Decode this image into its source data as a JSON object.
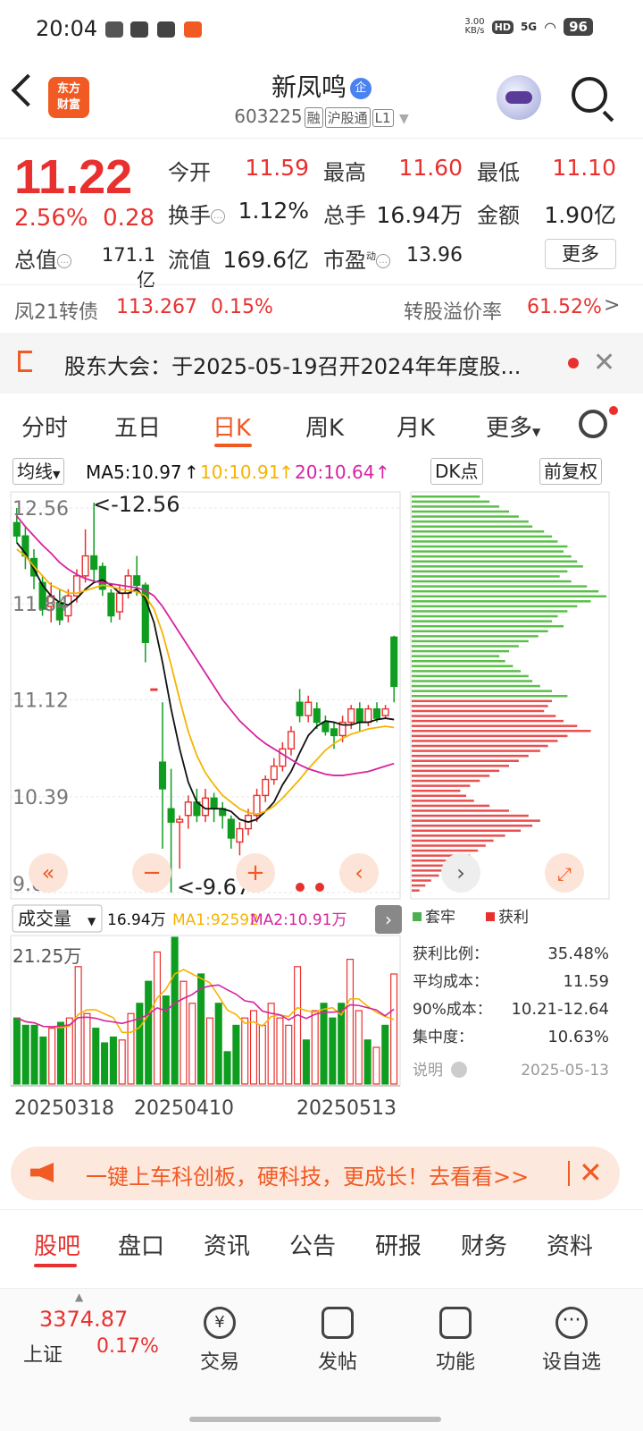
{
  "status_bar": {
    "time": "20:04",
    "net_speed_top": "3.00",
    "net_speed_unit": "KB/s",
    "hd": "HD",
    "network": "5G",
    "battery": "96"
  },
  "header": {
    "logo_line1": "东方",
    "logo_line2": "财富",
    "stock_name": "新凤鸣",
    "ent_badge": "企",
    "code": "603225",
    "tag_margin": "融",
    "tag_connect": "沪股通",
    "tag_level": "L1"
  },
  "quote": {
    "price": "11.22",
    "change_pct": "2.56%",
    "change_amt": "0.28",
    "open_label": "今开",
    "open": "11.59",
    "high_label": "最高",
    "high": "11.60",
    "low_label": "最低",
    "low": "11.10",
    "turnover_label": "换手",
    "turnover": "1.12%",
    "volume_label": "总手",
    "volume": "16.94万",
    "amount_label": "金额",
    "amount": "1.90亿",
    "mktcap_label": "总值",
    "mktcap": "171.1亿",
    "float_label": "流值",
    "float": "169.6亿",
    "pe_label": "市盈",
    "pe_sup": "动",
    "pe": "13.96",
    "more_button": "更多"
  },
  "bond": {
    "name": "凤21转债",
    "price": "113.267",
    "change": "0.15%",
    "premium_label": "转股溢价率",
    "premium": "61.52%"
  },
  "notice": {
    "text": "股东大会：于2025-05-19召开2024年年度股..."
  },
  "period_tabs": [
    "分时",
    "五日",
    "日K",
    "周K",
    "月K",
    "更多"
  ],
  "active_period": "日K",
  "ma_row": {
    "select": "均线",
    "ma5": "MA5:10.97",
    "ma10": "10:10.91",
    "ma20": "20:10.64",
    "dk": "DK点",
    "adjust": "前复权"
  },
  "colors": {
    "up": "#e8312f",
    "down": "#0f9d20",
    "ma5": "#111111",
    "ma10": "#f5b400",
    "ma20": "#d6249f",
    "brand": "#f15a22"
  },
  "chart_data": {
    "type": "candlestick",
    "y_ticks": [
      "12.56",
      "11.84",
      "11.12",
      "10.39",
      "9.67"
    ],
    "ylim": [
      9.67,
      12.56
    ],
    "max_label": "<-12.56",
    "min_label": "<-9.67",
    "x_labels": [
      "20250318",
      "20250410",
      "20250513"
    ],
    "candles": [
      {
        "o": 12.45,
        "c": 12.35,
        "h": 12.56,
        "l": 12.3
      },
      {
        "o": 12.35,
        "c": 12.2,
        "h": 12.42,
        "l": 12.1
      },
      {
        "o": 12.18,
        "c": 12.05,
        "h": 12.25,
        "l": 11.95
      },
      {
        "o": 12.0,
        "c": 11.8,
        "h": 12.05,
        "l": 11.75
      },
      {
        "o": 11.82,
        "c": 11.9,
        "h": 12.0,
        "l": 11.7
      },
      {
        "o": 11.85,
        "c": 11.72,
        "h": 11.95,
        "l": 11.68
      },
      {
        "o": 11.75,
        "c": 11.9,
        "h": 11.95,
        "l": 11.7
      },
      {
        "o": 11.9,
        "c": 12.05,
        "h": 12.1,
        "l": 11.85
      },
      {
        "o": 12.05,
        "c": 12.2,
        "h": 12.4,
        "l": 12.0
      },
      {
        "o": 12.2,
        "c": 12.1,
        "h": 12.6,
        "l": 12.0
      },
      {
        "o": 12.12,
        "c": 11.95,
        "h": 12.15,
        "l": 11.9
      },
      {
        "o": 11.92,
        "c": 11.75,
        "h": 11.95,
        "l": 11.7
      },
      {
        "o": 11.78,
        "c": 11.92,
        "h": 11.98,
        "l": 11.72
      },
      {
        "o": 11.92,
        "c": 12.05,
        "h": 12.1,
        "l": 11.88
      },
      {
        "o": 12.05,
        "c": 11.98,
        "h": 12.2,
        "l": 11.9
      },
      {
        "o": 11.98,
        "c": 11.55,
        "h": 12.0,
        "l": 11.4
      },
      {
        "o": 11.2,
        "c": 11.2,
        "h": 11.2,
        "l": 11.2
      },
      {
        "o": 10.65,
        "c": 10.45,
        "h": 11.1,
        "l": 10.0
      },
      {
        "o": 10.3,
        "c": 10.2,
        "h": 10.6,
        "l": 9.67
      },
      {
        "o": 10.2,
        "c": 10.22,
        "h": 10.25,
        "l": 9.85
      },
      {
        "o": 10.25,
        "c": 10.35,
        "h": 10.4,
        "l": 10.15
      },
      {
        "o": 10.35,
        "c": 10.25,
        "h": 10.45,
        "l": 10.2
      },
      {
        "o": 10.25,
        "c": 10.38,
        "h": 10.45,
        "l": 10.2
      },
      {
        "o": 10.38,
        "c": 10.3,
        "h": 10.42,
        "l": 10.2
      },
      {
        "o": 10.3,
        "c": 10.25,
        "h": 10.35,
        "l": 10.15
      },
      {
        "o": 10.22,
        "c": 10.08,
        "h": 10.25,
        "l": 10.0
      },
      {
        "o": 10.05,
        "c": 10.15,
        "h": 10.2,
        "l": 9.95
      },
      {
        "o": 10.15,
        "c": 10.25,
        "h": 10.3,
        "l": 10.1
      },
      {
        "o": 10.25,
        "c": 10.4,
        "h": 10.45,
        "l": 10.2
      },
      {
        "o": 10.4,
        "c": 10.52,
        "h": 10.55,
        "l": 10.35
      },
      {
        "o": 10.52,
        "c": 10.62,
        "h": 10.68,
        "l": 10.48
      },
      {
        "o": 10.62,
        "c": 10.75,
        "h": 10.8,
        "l": 10.58
      },
      {
        "o": 10.75,
        "c": 10.88,
        "h": 10.92,
        "l": 10.7
      },
      {
        "o": 11.1,
        "c": 11.0,
        "h": 11.2,
        "l": 10.95
      },
      {
        "o": 11.0,
        "c": 11.1,
        "h": 11.15,
        "l": 10.95
      },
      {
        "o": 11.05,
        "c": 10.95,
        "h": 11.1,
        "l": 10.9
      },
      {
        "o": 10.95,
        "c": 10.88,
        "h": 11.0,
        "l": 10.85
      },
      {
        "o": 10.9,
        "c": 10.85,
        "h": 10.95,
        "l": 10.75
      },
      {
        "o": 10.85,
        "c": 10.95,
        "h": 11.0,
        "l": 10.8
      },
      {
        "o": 10.95,
        "c": 11.05,
        "h": 11.08,
        "l": 10.9
      },
      {
        "o": 11.05,
        "c": 10.95,
        "h": 11.1,
        "l": 10.88
      },
      {
        "o": 10.95,
        "c": 11.05,
        "h": 11.08,
        "l": 10.92
      },
      {
        "o": 11.05,
        "c": 10.98,
        "h": 11.1,
        "l": 10.95
      },
      {
        "o": 11.0,
        "c": 11.05,
        "h": 11.08,
        "l": 10.98
      },
      {
        "o": 11.59,
        "c": 11.22,
        "h": 11.6,
        "l": 11.1
      }
    ],
    "ma5": [
      12.3,
      12.22,
      12.1,
      11.98,
      11.9,
      11.85,
      11.83,
      11.88,
      11.95,
      12.0,
      12.02,
      11.98,
      11.92,
      11.92,
      11.95,
      11.88,
      11.7,
      11.4,
      11.05,
      10.75,
      10.5,
      10.35,
      10.3,
      10.3,
      10.3,
      10.28,
      10.22,
      10.2,
      10.22,
      10.28,
      10.35,
      10.48,
      10.58,
      10.72,
      10.85,
      10.92,
      10.96,
      10.95,
      10.93,
      10.93,
      10.95,
      10.95,
      10.97,
      10.98,
      10.97
    ],
    "ma10": [
      12.25,
      12.2,
      12.12,
      12.05,
      11.98,
      11.95,
      11.92,
      11.92,
      11.94,
      11.96,
      11.98,
      11.97,
      11.95,
      11.94,
      11.93,
      11.9,
      11.8,
      11.62,
      11.38,
      11.12,
      10.88,
      10.7,
      10.57,
      10.48,
      10.4,
      10.35,
      10.3,
      10.27,
      10.26,
      10.28,
      10.32,
      10.38,
      10.45,
      10.52,
      10.6,
      10.67,
      10.74,
      10.79,
      10.83,
      10.86,
      10.88,
      10.9,
      10.91,
      10.92,
      10.91
    ],
    "ma20": [
      12.5,
      12.42,
      12.35,
      12.28,
      12.22,
      12.15,
      12.1,
      12.06,
      12.03,
      12.01,
      12.0,
      11.99,
      11.98,
      11.97,
      11.96,
      11.94,
      11.9,
      11.82,
      11.72,
      11.62,
      11.52,
      11.42,
      11.32,
      11.22,
      11.12,
      11.04,
      10.96,
      10.9,
      10.84,
      10.79,
      10.75,
      10.71,
      10.67,
      10.63,
      10.6,
      10.58,
      10.56,
      10.55,
      10.55,
      10.56,
      10.57,
      10.58,
      10.6,
      10.62,
      10.64
    ],
    "dk": {
      "legend_trapped": "套牢",
      "legend_profit": "获利",
      "profit_ratio_label": "获利比例：",
      "profit_ratio": "35.48%",
      "avg_cost_label": "平均成本：",
      "avg_cost": "11.59",
      "cost90_label": "90%成本：",
      "cost90": "10.21-12.64",
      "concentration_label": "集中度：",
      "concentration": "10.63%",
      "note_label": "说明",
      "date": "2025-05-13",
      "trapped_bars": [
        0.35,
        0.4,
        0.45,
        0.5,
        0.55,
        0.6,
        0.62,
        0.68,
        0.72,
        0.75,
        0.8,
        0.78,
        0.82,
        0.85,
        0.88,
        0.8,
        0.76,
        0.82,
        0.9,
        0.96,
        1.0,
        0.92,
        0.85,
        0.8,
        0.75,
        0.72,
        0.78,
        0.7,
        0.65,
        0.6,
        0.55,
        0.5,
        0.45,
        0.48,
        0.52,
        0.56,
        0.6,
        0.62,
        0.66,
        0.72,
        0.8
      ],
      "profit_bars": [
        0.72,
        0.7,
        0.68,
        0.74,
        0.78,
        0.85,
        0.92,
        0.8,
        0.75,
        0.7,
        0.66,
        0.6,
        0.55,
        0.5,
        0.45,
        0.4,
        0.35,
        0.3,
        0.25,
        0.28,
        0.32,
        0.4,
        0.5,
        0.6,
        0.66,
        0.62,
        0.56,
        0.48,
        0.42,
        0.38,
        0.34,
        0.3,
        0.26,
        0.22,
        0.18,
        0.14,
        0.1,
        0.07,
        0.04
      ]
    },
    "volume": {
      "select": "成交量",
      "vol": "16.94万",
      "ma1": "MA1:92592",
      "ma2": "MA2:10.91万",
      "ylabel": "21.25万",
      "bars": [
        0.45,
        0.4,
        0.4,
        0.32,
        0.38,
        0.42,
        0.45,
        0.8,
        0.48,
        0.38,
        0.28,
        0.32,
        0.3,
        0.48,
        0.55,
        0.7,
        0.9,
        0.6,
        1.0,
        0.7,
        0.55,
        0.75,
        0.45,
        0.55,
        0.22,
        0.4,
        0.45,
        0.5,
        0.4,
        0.55,
        0.45,
        0.4,
        0.8,
        0.3,
        0.5,
        0.55,
        0.45,
        0.55,
        0.85,
        0.5,
        0.3,
        0.25,
        0.4,
        0.75
      ]
    }
  },
  "promo": {
    "text": "一键上车科创板，硬科技，更成长！去看看>>"
  },
  "bottom_tabs": [
    "股吧",
    "盘口",
    "资讯",
    "公告",
    "研报",
    "财务",
    "资料"
  ],
  "bottom_bar": {
    "index_value": "3374.87",
    "index_name": "上证",
    "index_change": "0.17%",
    "trade": "交易",
    "post": "发帖",
    "functions": "功能",
    "watchlist": "设自选"
  }
}
